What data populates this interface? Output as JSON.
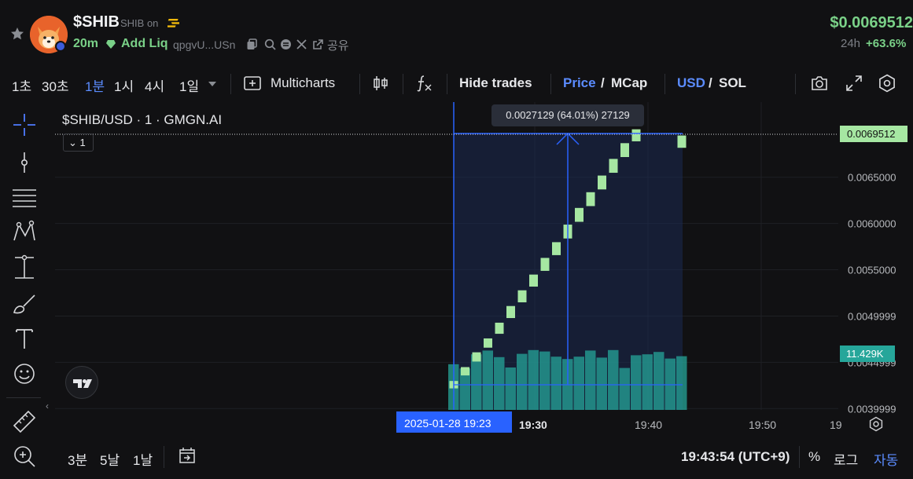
{
  "header": {
    "token_symbol": "$SHIB",
    "token_name": "SHIB on",
    "age": "20m",
    "add_liq": "Add Liq",
    "address": "qpgvU...USn",
    "share": "공유",
    "price": "$0.0069512",
    "change_label": "24h",
    "change_value": "+63.6%"
  },
  "toolbar": {
    "intervals": [
      "1초",
      "30초",
      "1분",
      "1시",
      "4시",
      "1일"
    ],
    "active_interval": "1분",
    "multicharts": "Multicharts",
    "hide_trades": "Hide trades",
    "price": "Price",
    "slash1": "/",
    "mcap": "MCap",
    "usd": "USD",
    "slash2": "/",
    "sol": "SOL"
  },
  "legend": {
    "title": "$SHIB/USD · 1 · GMGN.AI",
    "interval_box": "1"
  },
  "measure": {
    "tooltip": "0.0027129 (64.01%) 27129"
  },
  "tags": {
    "price": "0.0069512",
    "volume": "11.429K",
    "date": "2025-01-28   19:23"
  },
  "x_ticks": [
    "19:30",
    "19:40",
    "19:50",
    "19"
  ],
  "bottom": {
    "ranges": [
      "3분",
      "5날",
      "1날"
    ],
    "time": "19:43:54 (UTC+9)",
    "percent": "%",
    "log": "로그",
    "auto": "자동"
  },
  "colors": {
    "up": "#a6e7a2",
    "volume": "#26a69a",
    "accent": "#2962ff",
    "price_green": "#7ad188"
  },
  "chart_data": {
    "type": "candlestick",
    "title": "$SHIB/USD · 1 · GMGN.AI",
    "x_unit": "minute (2025-01-28)",
    "y_ticks": [
      "0.0065000",
      "0.0060000",
      "0.0055000",
      "0.0049999",
      "0.0044999",
      "0.0039999"
    ],
    "ylim": [
      0.0039,
      0.0071
    ],
    "candles": [
      {
        "t": "19:23",
        "open": 0.004218,
        "close": 0.004298
      },
      {
        "t": "19:24",
        "open": 0.004358,
        "close": 0.004448
      },
      {
        "t": "19:25",
        "open": 0.004508,
        "close": 0.004608
      },
      {
        "t": "19:26",
        "open": 0.004658,
        "close": 0.004758
      },
      {
        "t": "19:27",
        "open": 0.004808,
        "close": 0.004928
      },
      {
        "t": "19:28",
        "open": 0.004978,
        "close": 0.005108
      },
      {
        "t": "19:29",
        "open": 0.005148,
        "close": 0.005278
      },
      {
        "t": "19:30",
        "open": 0.005318,
        "close": 0.005448
      },
      {
        "t": "19:31",
        "open": 0.005488,
        "close": 0.005628
      },
      {
        "t": "19:32",
        "open": 0.005658,
        "close": 0.005798
      },
      {
        "t": "19:33",
        "open": 0.005838,
        "close": 0.005988
      },
      {
        "t": "19:34",
        "open": 0.006018,
        "close": 0.006168
      },
      {
        "t": "19:35",
        "open": 0.006188,
        "close": 0.006338
      },
      {
        "t": "19:36",
        "open": 0.006368,
        "close": 0.006518
      },
      {
        "t": "19:37",
        "open": 0.006548,
        "close": 0.006698
      },
      {
        "t": "19:38",
        "open": 0.006718,
        "close": 0.006868
      },
      {
        "t": "19:39",
        "open": 0.006888,
        "close": 0.007018
      },
      {
        "t": "19:40",
        "open": 0.007018,
        "close": 0.007018
      },
      {
        "t": "19:41",
        "open": 0.007018,
        "close": 0.007018
      },
      {
        "t": "19:42",
        "open": 0.007018,
        "close": 0.007018
      },
      {
        "t": "19:43",
        "open": 0.006818,
        "close": 0.006951
      }
    ],
    "volume": [
      9.7,
      8.8,
      11.8,
      12.6,
      11.2,
      9.0,
      11.9,
      12.7,
      12.4,
      11.3,
      10.8,
      11.3,
      12.6,
      11.1,
      12.7,
      8.9,
      11.6,
      11.8,
      12.3,
      10.9,
      11.4
    ],
    "volume_ymax": 14.8,
    "last_price": 0.0069512,
    "last_volume": "11.429K",
    "measure": {
      "from": 0.0042383,
      "to": 0.0069512,
      "change": "0.0027129",
      "percent": "64.01%",
      "ticks": 27129
    }
  }
}
